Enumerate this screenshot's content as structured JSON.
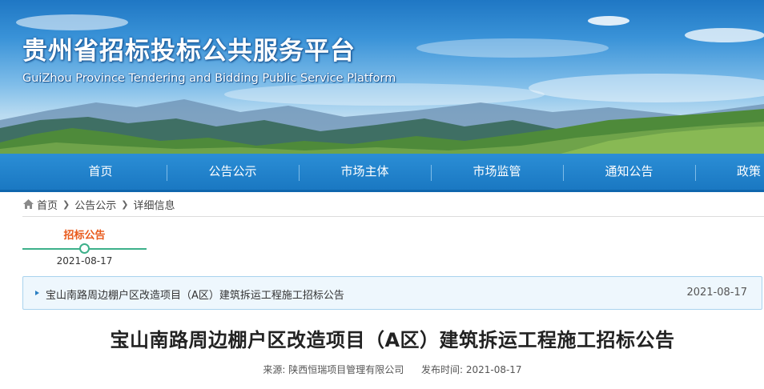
{
  "header": {
    "title": "贵州省招标投标公共服务平台",
    "subtitle": "GuiZhou Province Tendering and Bidding Public Service Platform"
  },
  "nav": {
    "items": [
      "首页",
      "公告公示",
      "市场主体",
      "市场监管",
      "通知公告",
      "政策"
    ]
  },
  "breadcrumb": {
    "home": "首页",
    "level1": "公告公示",
    "level2": "详细信息",
    "home_icon": "home-icon",
    "separator_icon": "chevron-right-icon"
  },
  "timeline": {
    "label": "招标公告",
    "date": "2021-08-17"
  },
  "notice": {
    "title": "宝山南路周边棚户区改造项目（A区）建筑拆运工程施工招标公告",
    "date": "2021-08-17"
  },
  "article": {
    "title": "宝山南路周边棚户区改造项目（A区）建筑拆运工程施工招标公告",
    "source_label": "来源:",
    "source": "陕西恒瑞项目管理有限公司",
    "publish_label": "发布时间:",
    "publish_date": "2021-08-17"
  },
  "colors": {
    "nav_bg": "#1a78c2",
    "accent_orange": "#e8591a",
    "timeline_green": "#3db08a",
    "notice_bg": "#eef7fd"
  }
}
